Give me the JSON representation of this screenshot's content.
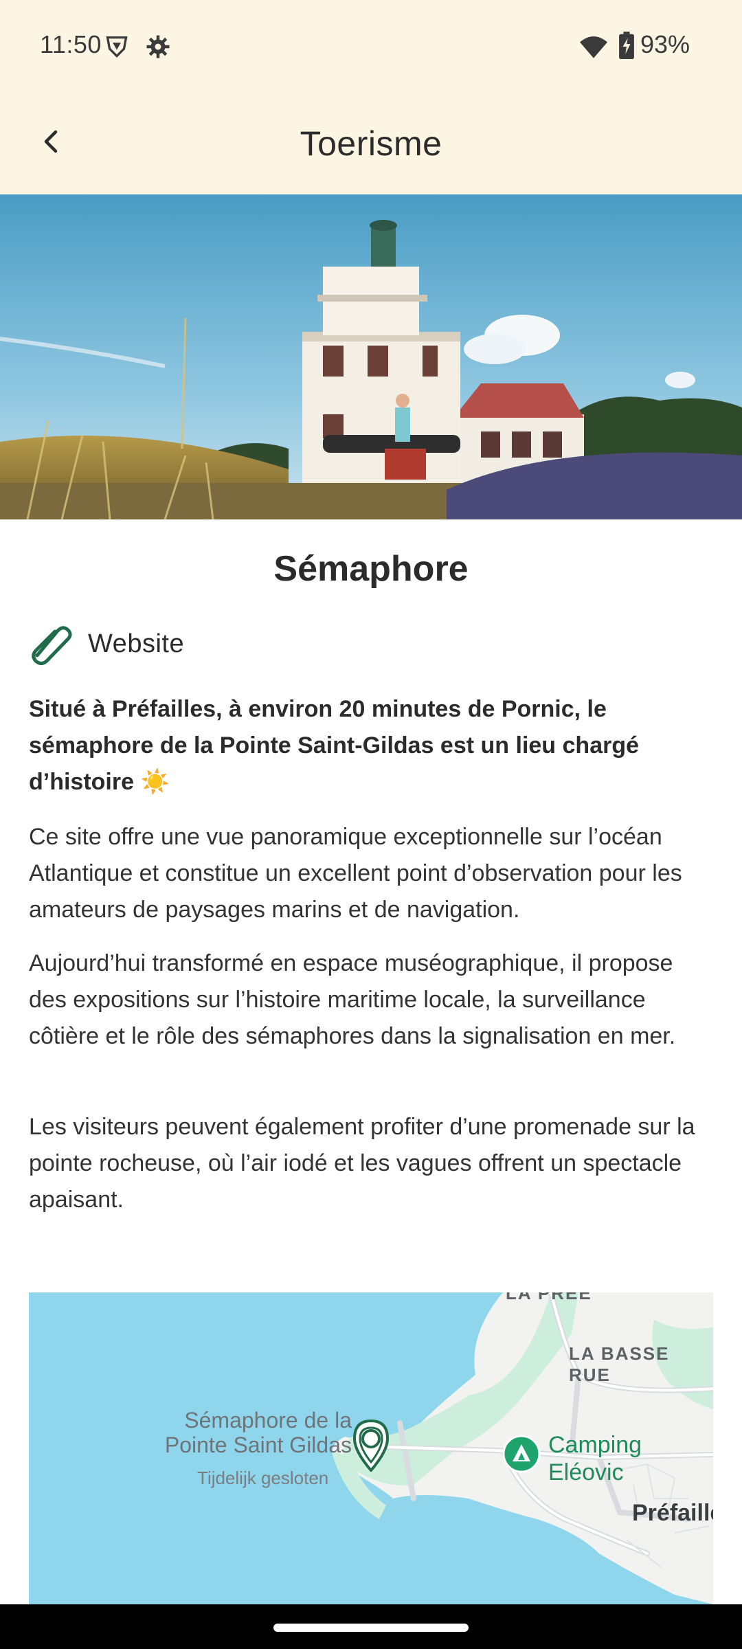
{
  "status_bar": {
    "time": "11:50",
    "battery": "93%",
    "icons": [
      "vpn-shield-icon",
      "settings-gear-icon",
      "wifi-icon",
      "battery-charging-icon"
    ]
  },
  "app_bar": {
    "title": "Toerisme",
    "back_icon": "chevron-left-icon"
  },
  "poi": {
    "title": "Sémaphore",
    "website_label": "Website",
    "website_icon": "paperclip-icon",
    "intro": "Situé à Préfailles, à environ 20 minutes de Pornic, le sémaphore de la Pointe Saint-Gildas est un lieu chargé d’histoire ☀️",
    "paragraphs": [
      "Ce site offre une vue panoramique exceptionnelle sur l’océan Atlantique et constitue un excellent point d’observation pour les amateurs de paysages marins et de navigation.",
      "Aujourd’hui transformé en espace muséographique, il propose des expositions sur l’histoire maritime locale, la surveillance côtière et le rôle des sémaphores dans la signalisation en mer.",
      "Les visiteurs peuvent également profiter d’une promenade sur la pointe rocheuse, où l’air iodé et les vagues offrent un spectacle apaisant."
    ]
  },
  "map": {
    "labels": {
      "la_pree": "LA PREE",
      "la_basse_rue": "LA BASSE RUE",
      "poi_name_line1": "Sémaphore de la",
      "poi_name_line2": "Pointe Saint Gildas",
      "poi_status": "Tijdelijk gesloten",
      "camping_line1": "Camping",
      "camping_line2": "Eléovic",
      "town": "Préfailles"
    },
    "colors": {
      "sea": "#8fd6ec",
      "land": "#f2f3f0",
      "park": "#cdeedd",
      "accent": "#1f6b4a"
    }
  },
  "colors": {
    "header_bg": "#fdf5e3",
    "accent_green": "#1f6b4a"
  }
}
